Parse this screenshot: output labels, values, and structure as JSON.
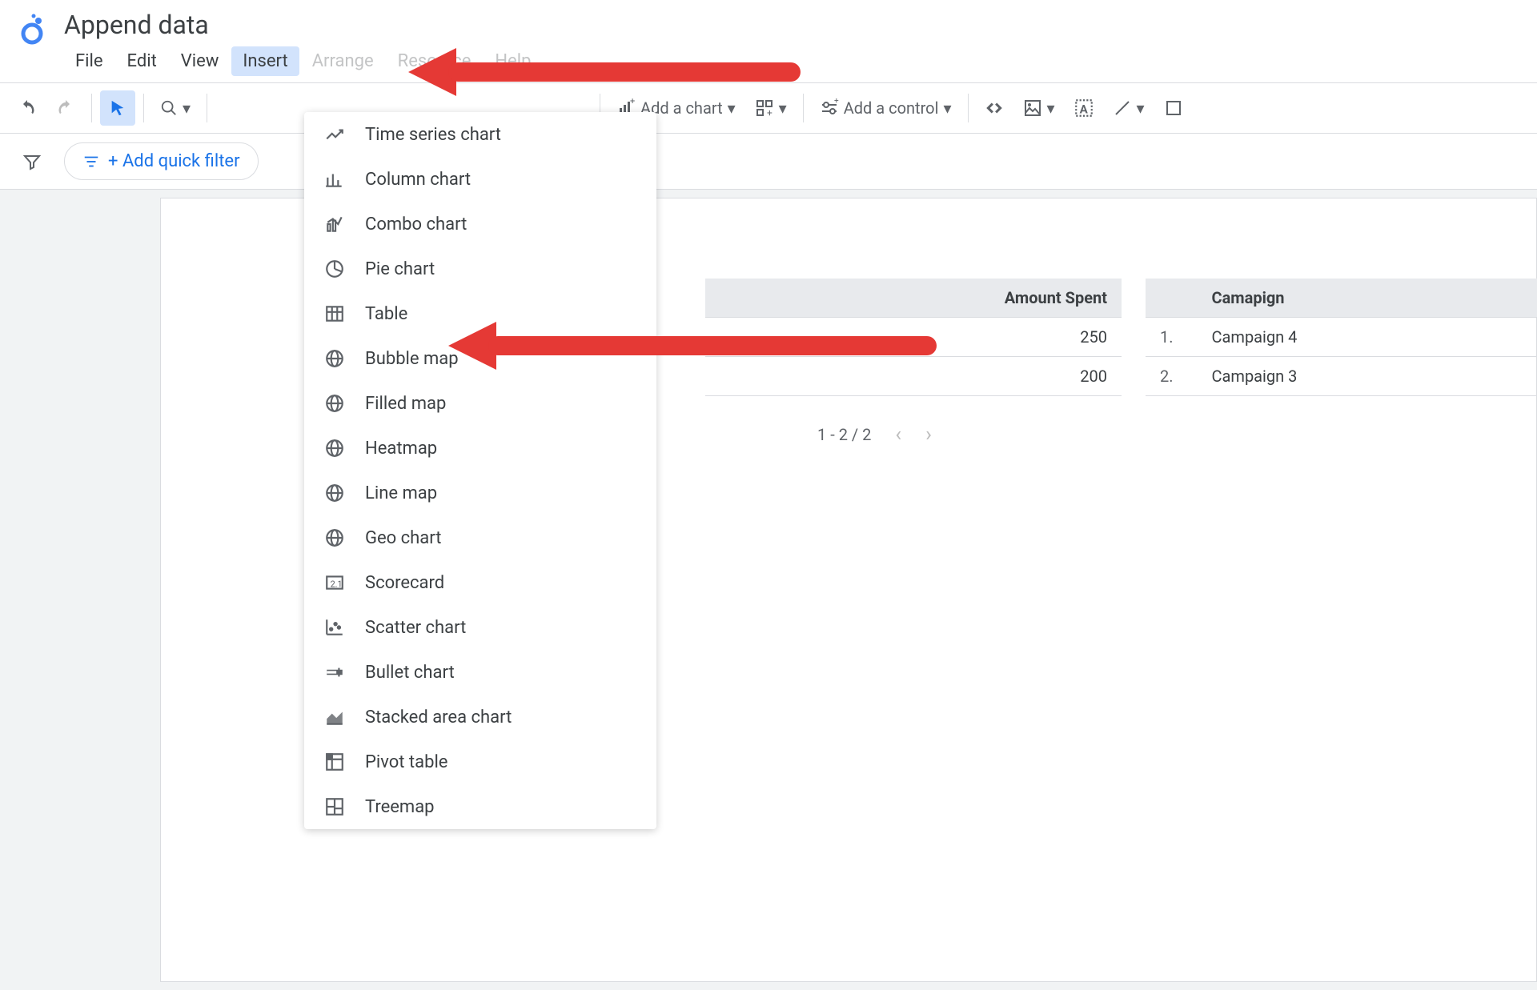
{
  "document": {
    "title": "Append data"
  },
  "menubar": {
    "items": [
      "File",
      "Edit",
      "View",
      "Insert",
      "Arrange",
      "Resource",
      "Help"
    ],
    "active": "Insert"
  },
  "toolbar": {
    "add_chart": "Add a chart",
    "add_control": "Add a control"
  },
  "filterbar": {
    "quick_filter": "+ Add quick filter"
  },
  "insert_menu": {
    "items": [
      {
        "icon": "timeseries",
        "label": "Time series chart"
      },
      {
        "icon": "column",
        "label": "Column chart"
      },
      {
        "icon": "combo",
        "label": "Combo chart"
      },
      {
        "icon": "pie",
        "label": "Pie chart"
      },
      {
        "icon": "table",
        "label": "Table"
      },
      {
        "icon": "globe",
        "label": "Bubble map"
      },
      {
        "icon": "globe",
        "label": "Filled map"
      },
      {
        "icon": "globe",
        "label": "Heatmap"
      },
      {
        "icon": "globe",
        "label": "Line map"
      },
      {
        "icon": "globe",
        "label": "Geo chart"
      },
      {
        "icon": "scorecard",
        "label": "Scorecard"
      },
      {
        "icon": "scatter",
        "label": "Scatter chart"
      },
      {
        "icon": "bullet",
        "label": "Bullet chart"
      },
      {
        "icon": "area",
        "label": "Stacked area chart"
      },
      {
        "icon": "pivot",
        "label": "Pivot table"
      },
      {
        "icon": "treemap",
        "label": "Treemap"
      }
    ]
  },
  "table1": {
    "header": "Amount Spent",
    "rows": [
      "250",
      "200"
    ],
    "pagination": "1 - 2 / 2"
  },
  "table2": {
    "header": "Camapign",
    "rows": [
      {
        "idx": "1.",
        "val": "Campaign 4"
      },
      {
        "idx": "2.",
        "val": "Campaign 3"
      }
    ]
  }
}
